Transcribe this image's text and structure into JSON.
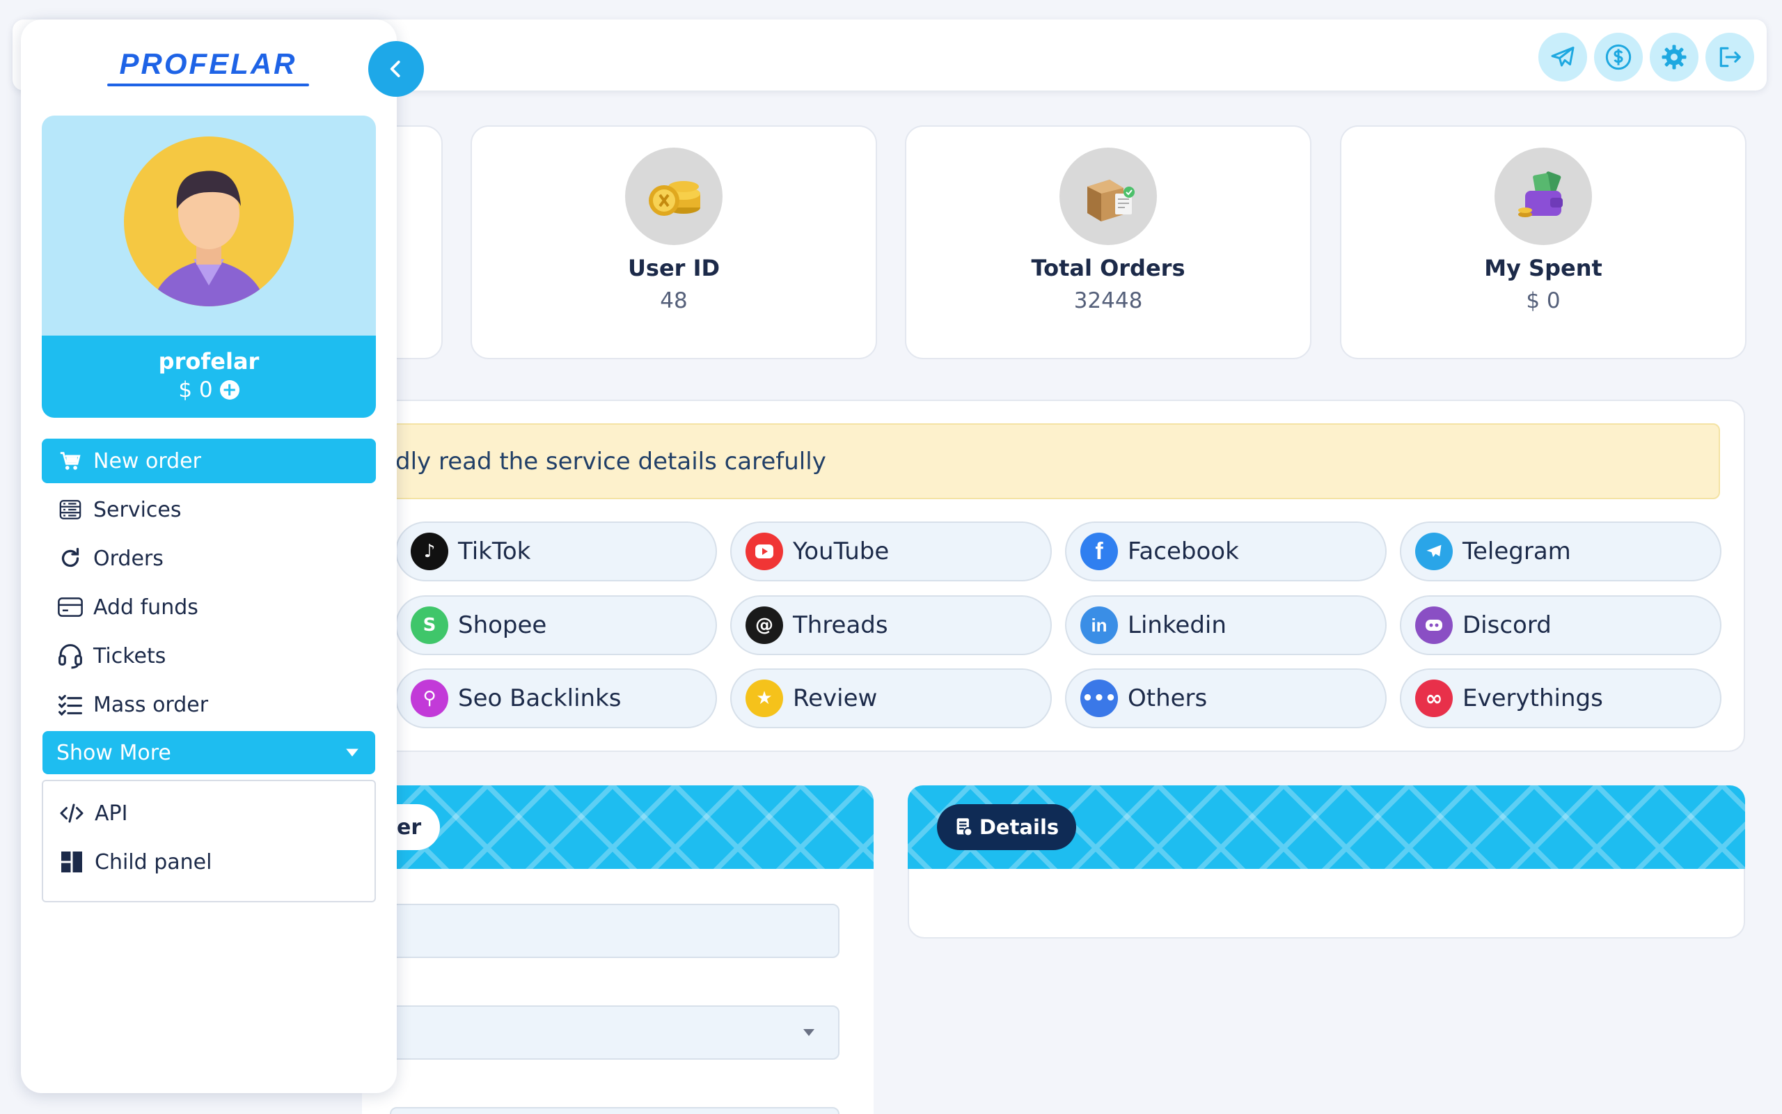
{
  "brand": {
    "logo_text": "PROFELAR"
  },
  "user": {
    "name": "profelar",
    "balance": "$ 0"
  },
  "menu": [
    {
      "label": "New order",
      "icon": "cart-icon",
      "active": true
    },
    {
      "label": "Services",
      "icon": "server-list-icon"
    },
    {
      "label": "Orders",
      "icon": "refresh-icon"
    },
    {
      "label": "Add funds",
      "icon": "credit-card-icon"
    },
    {
      "label": "Tickets",
      "icon": "headset-icon"
    },
    {
      "label": "Mass order",
      "icon": "checklist-icon"
    }
  ],
  "show_more": {
    "label": "Show More",
    "items": [
      {
        "label": "API",
        "icon": "code-icon"
      },
      {
        "label": "Child panel",
        "icon": "panel-grid-icon"
      }
    ]
  },
  "topbar_icons": [
    "telegram-icon",
    "dollar-circle-icon",
    "gear-icon",
    "logout-icon"
  ],
  "stats": [
    {
      "label": "User ID",
      "value": "48",
      "icon": "coins-icon"
    },
    {
      "label": "Total Orders",
      "value": "32448",
      "icon": "boxes-icon"
    },
    {
      "label": "My Spent",
      "value": "$ 0",
      "icon": "wallet-icon"
    }
  ],
  "notice": "dly read the service details carefully",
  "platforms": [
    {
      "label": "TikTok",
      "icon": "tiktok-icon",
      "color": "#111111"
    },
    {
      "label": "YouTube",
      "icon": "youtube-icon",
      "color": "#f03535"
    },
    {
      "label": "Facebook",
      "icon": "facebook-icon",
      "color": "#2f7ff0"
    },
    {
      "label": "Telegram",
      "icon": "telegram-icon",
      "color": "#2aa5e8"
    },
    {
      "label": "Shopee",
      "icon": "shopee-icon",
      "color": "#3fc66a"
    },
    {
      "label": "Threads",
      "icon": "threads-icon",
      "color": "#1a1a1a"
    },
    {
      "label": "Linkedin",
      "icon": "linkedin-icon",
      "color": "#3a8ee6"
    },
    {
      "label": "Discord",
      "icon": "discord-icon",
      "color": "#8a4fc4"
    },
    {
      "label": "Seo Backlinks",
      "icon": "seo-icon",
      "color": "#c23ad8"
    },
    {
      "label": "Review",
      "icon": "review-icon",
      "color": "#f5c21b"
    },
    {
      "label": "Others",
      "icon": "dots-icon",
      "color": "#3a78e8"
    },
    {
      "label": "Everythings",
      "icon": "infinity-icon",
      "color": "#e8304a"
    }
  ],
  "order_tab_fragment": "er",
  "details_label": "Details",
  "colors": {
    "accent": "#1ebdf0",
    "dark_navy": "#0f2b55",
    "notice_bg": "#fdf1cc"
  }
}
